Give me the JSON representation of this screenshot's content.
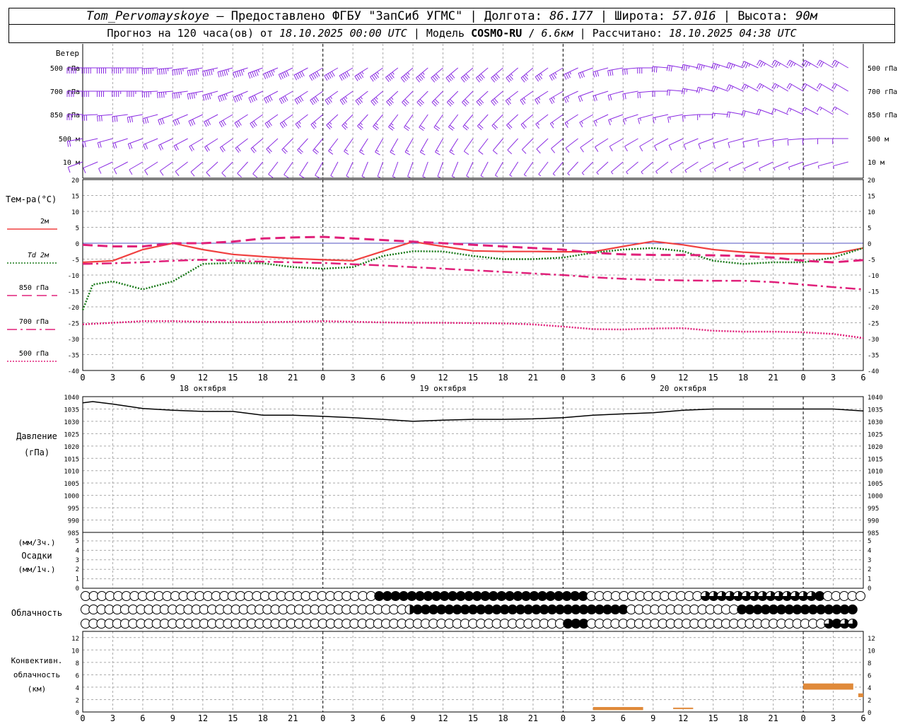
{
  "header": {
    "station": "Tom_Pervomayskoye",
    "provided_by": "Предоставлено ФГБУ \"ЗапСиб УГМС\"",
    "lon_label": "Долгота:",
    "lon_value": "86.177",
    "lat_label": "Широта:",
    "lat_value": "57.016",
    "alt_label": "Высота:",
    "alt_value": "90м",
    "forecast_label": "Прогноз на 120 часа(ов) от",
    "forecast_start": "18.10.2025 00:00 UTC",
    "model_label": "Модель",
    "model_name": "COSMO-RU",
    "model_res": "6.6км",
    "computed_label": "Рассчитано:",
    "computed_time": "18.10.2025 04:38 UTC"
  },
  "colors": {
    "wind": "#8a2be2",
    "t2m": "#f04040",
    "td2m": "#1a7a1a",
    "t850": "#e0207a",
    "t700": "#e0207a",
    "t500": "#e0207a",
    "pressure": "#000000",
    "conv_cloud": "#e08a3a",
    "grid": "#aaaaaa"
  },
  "time_axis": {
    "hour_labels": [
      "0",
      "3",
      "6",
      "9",
      "12",
      "15",
      "18",
      "21",
      "0",
      "3",
      "6",
      "9",
      "12",
      "15",
      "18",
      "21",
      "0",
      "3",
      "6",
      "9",
      "12",
      "15",
      "18",
      "21",
      "0",
      "3",
      "6"
    ],
    "day_labels": [
      {
        "label": "18 октября",
        "hour": 12
      },
      {
        "label": "19 октября",
        "hour": 36
      },
      {
        "label": "20 октября",
        "hour": 60
      }
    ]
  },
  "wind_panel": {
    "title": "Ветер",
    "levels": [
      "500 гПа",
      "700 гПа",
      "850 гПа",
      "500 м",
      "10  м"
    ]
  },
  "temp_panel": {
    "title": "Тем-ра(°C)",
    "legend": [
      {
        "label": "2м",
        "key": "t2m"
      },
      {
        "label": "Td  2м",
        "key": "td2m"
      },
      {
        "label": "850 гПа",
        "key": "t850"
      },
      {
        "label": "700 гПа",
        "key": "t700"
      },
      {
        "label": "500 гПа",
        "key": "t500"
      }
    ],
    "ticks": [
      "20",
      "15",
      "10",
      "5",
      "0",
      "-5",
      "-10",
      "-15",
      "-20",
      "-25",
      "-30",
      "-35",
      "-40"
    ]
  },
  "pressure_panel": {
    "title1": "Давление",
    "title2": "(гПа)",
    "ticks": [
      "1040",
      "1035",
      "1030",
      "1025",
      "1020",
      "1015",
      "1010",
      "1005",
      "1000",
      "995",
      "990",
      "985"
    ]
  },
  "precip_panel": {
    "title1": "(мм/3ч.)",
    "title2": "Осадки",
    "title3": "(мм/1ч.)",
    "ticks": [
      "5",
      "4",
      "3",
      "2",
      "1",
      "0"
    ]
  },
  "cloud_panel": {
    "title": "Облачность"
  },
  "conv_panel": {
    "title1": "Конвективн.",
    "title2": "облачность",
    "title3": "(км)",
    "ticks": [
      "12",
      "10",
      "8",
      "6",
      "4",
      "2",
      "0"
    ]
  },
  "chart_data": {
    "type": "line",
    "x_unit": "hours since 18.10.2025 00:00 UTC",
    "xlim": [
      0,
      78
    ],
    "temperature": {
      "ylim": [
        -40,
        20
      ],
      "series": [
        {
          "name": "2м",
          "key": "t2m",
          "style": "solid",
          "x": [
            0,
            3,
            6,
            9,
            12,
            15,
            18,
            21,
            24,
            27,
            30,
            33,
            36,
            39,
            42,
            45,
            48,
            51,
            54,
            57,
            60,
            63,
            66,
            69,
            72,
            75,
            78
          ],
          "y": [
            -6,
            -5.5,
            -2,
            0,
            -2,
            -3.5,
            -4.2,
            -4.8,
            -5.2,
            -5.5,
            -2.5,
            0.5,
            -1,
            -2.4,
            -2.6,
            -2.6,
            -2.7,
            -2.7,
            -1,
            0.6,
            -0.5,
            -2,
            -2.8,
            -3.3,
            -3.3,
            -3.3,
            -1.5
          ]
        },
        {
          "name": "Td  2м",
          "key": "td2m",
          "style": "dotted",
          "x": [
            0,
            1,
            3,
            6,
            9,
            12,
            15,
            18,
            21,
            24,
            27,
            30,
            33,
            36,
            39,
            42,
            45,
            48,
            51,
            54,
            57,
            60,
            63,
            66,
            69,
            72,
            75,
            78
          ],
          "y": [
            -21,
            -13,
            -12,
            -14.5,
            -12,
            -6.5,
            -6.2,
            -6.3,
            -7.5,
            -8,
            -7.5,
            -4,
            -2.5,
            -2.6,
            -4,
            -5,
            -5,
            -4.5,
            -3,
            -2,
            -1.5,
            -2.5,
            -5.5,
            -6.5,
            -6,
            -6,
            -4.5,
            -1.5
          ]
        },
        {
          "name": "850 гПа",
          "key": "t850",
          "style": "dashed",
          "x": [
            0,
            3,
            6,
            9,
            12,
            15,
            18,
            21,
            24,
            27,
            30,
            33,
            36,
            39,
            42,
            45,
            48,
            51,
            54,
            57,
            60,
            63,
            66,
            69,
            72,
            75,
            78
          ],
          "y": [
            -0.5,
            -1,
            -1,
            0,
            0,
            0.5,
            1.5,
            1.8,
            2,
            1.5,
            1,
            0.5,
            0,
            -0.5,
            -1,
            -1.5,
            -2,
            -3,
            -3.5,
            -3.7,
            -3.7,
            -3.8,
            -4,
            -4.5,
            -5.5,
            -6,
            -5.3
          ]
        },
        {
          "name": "700 гПа",
          "key": "t700",
          "style": "dashdot",
          "x": [
            0,
            3,
            6,
            9,
            12,
            15,
            18,
            21,
            24,
            27,
            30,
            33,
            36,
            39,
            42,
            45,
            48,
            51,
            54,
            57,
            60,
            63,
            66,
            69,
            72,
            75,
            78
          ],
          "y": [
            -6.5,
            -6.3,
            -6,
            -5.5,
            -5.2,
            -5.5,
            -5.8,
            -6,
            -6.2,
            -6.6,
            -7,
            -7.5,
            -8,
            -8.5,
            -9,
            -9.5,
            -10,
            -10.7,
            -11.2,
            -11.5,
            -11.7,
            -11.8,
            -11.8,
            -12.2,
            -13,
            -13.8,
            -14.5
          ]
        },
        {
          "name": "500 гПа",
          "key": "t500",
          "style": "fine",
          "x": [
            0,
            3,
            6,
            9,
            12,
            15,
            18,
            21,
            24,
            27,
            30,
            33,
            36,
            39,
            42,
            45,
            48,
            51,
            54,
            57,
            60,
            63,
            66,
            69,
            72,
            75,
            78
          ],
          "y": [
            -25.5,
            -25,
            -24.5,
            -24.5,
            -24.7,
            -24.8,
            -24.8,
            -24.7,
            -24.5,
            -24.7,
            -24.9,
            -25,
            -25,
            -25.1,
            -25.2,
            -25.5,
            -26.2,
            -27,
            -27.1,
            -26.8,
            -26.7,
            -27.5,
            -27.8,
            -27.8,
            -28,
            -28.5,
            -29.8
          ]
        }
      ]
    },
    "pressure": {
      "ylim": [
        985,
        1040
      ],
      "x": [
        0,
        1,
        3,
        6,
        9,
        12,
        15,
        18,
        21,
        24,
        27,
        30,
        33,
        36,
        39,
        42,
        45,
        48,
        51,
        54,
        57,
        60,
        63,
        66,
        69,
        72,
        75,
        78
      ],
      "y": [
        1037.5,
        1038,
        1037,
        1035.2,
        1034.5,
        1034,
        1034,
        1032.5,
        1032.5,
        1032,
        1031.5,
        1030.8,
        1030,
        1030.5,
        1030.8,
        1030.8,
        1031,
        1031.5,
        1032.5,
        1033,
        1033.5,
        1034.5,
        1035,
        1035,
        1035,
        1035,
        1035,
        1034.2
      ]
    },
    "precipitation": {
      "ylim": [
        0,
        5
      ],
      "values": []
    },
    "cloud_cover": {
      "x_step_hours": 1,
      "x_start_hours": 0,
      "rows": [
        {
          "name": "upper",
          "values": "000000000000000000000000000000000000OOOOOOOOOOOOOOOOOOOOOOOOOO00000000000000ooooooooooooooO00000"
        },
        {
          "name": "middle",
          "values": "00000000000000000000000000000000000000000hOOOOOOOOOOOOOOOOOOOOOOOOOOO00000000000000OOOOOOOOOOOOOOOO"
        },
        {
          "name": "lower",
          "values": "0000000000000000000000000000000000000000000000000000000000000OOO000000000000000000000000000000oOooO"
        }
      ]
    },
    "convective_cloud": {
      "ylim": [
        0,
        13
      ],
      "segments": [
        {
          "x0": 51,
          "x1": 56,
          "base": 0.3,
          "top": 0.8
        },
        {
          "x0": 59,
          "x1": 61,
          "base": 0.6,
          "top": 0.7
        },
        {
          "x0": 72,
          "x1": 77,
          "base": 3.6,
          "top": 4.6
        },
        {
          "x0": 77.5,
          "x1": 78,
          "base": 2.4,
          "top": 3.0
        }
      ]
    },
    "wind": {
      "levels": [
        "500 гПа",
        "700 гПа",
        "850 гПа",
        "500 м",
        "10  м"
      ],
      "direction_deg": [
        [
          270,
          270,
          270,
          265,
          260,
          255,
          250,
          245,
          240,
          240,
          235,
          230,
          230,
          230,
          230,
          230,
          240,
          250,
          260,
          270,
          280,
          285,
          290,
          300,
          300,
          300,
          300
        ],
        [
          270,
          270,
          270,
          265,
          260,
          250,
          245,
          240,
          235,
          235,
          230,
          225,
          225,
          225,
          230,
          235,
          240,
          250,
          255,
          265,
          275,
          285,
          295,
          300,
          300,
          300,
          300
        ],
        [
          270,
          265,
          260,
          250,
          245,
          240,
          235,
          235,
          230,
          225,
          220,
          215,
          215,
          220,
          225,
          230,
          235,
          240,
          250,
          255,
          260,
          270,
          280,
          290,
          295,
          300,
          300
        ],
        [
          260,
          255,
          250,
          245,
          240,
          235,
          230,
          225,
          220,
          215,
          210,
          210,
          210,
          215,
          220,
          225,
          230,
          235,
          240,
          240,
          245,
          250,
          255,
          260,
          265,
          270,
          270
        ],
        [
          250,
          245,
          240,
          235,
          230,
          225,
          220,
          215,
          210,
          205,
          200,
          200,
          200,
          205,
          210,
          215,
          220,
          225,
          230,
          230,
          235,
          240,
          245,
          245,
          250,
          255,
          255
        ]
      ],
      "speed_ms": [
        [
          25,
          26,
          27,
          28,
          28,
          28,
          27,
          26,
          25,
          24,
          23,
          22,
          21,
          20,
          19,
          18,
          17,
          16,
          15,
          15,
          16,
          17,
          18,
          18,
          17,
          16,
          15
        ],
        [
          20,
          21,
          22,
          22,
          22,
          22,
          21,
          20,
          19,
          18,
          17,
          16,
          15,
          15,
          14,
          13,
          12,
          11,
          10,
          10,
          11,
          12,
          12,
          12,
          11,
          10,
          10
        ],
        [
          14,
          15,
          16,
          16,
          16,
          15,
          15,
          14,
          13,
          13,
          12,
          11,
          10,
          10,
          9,
          9,
          8,
          8,
          7,
          7,
          8,
          8,
          9,
          9,
          8,
          7,
          7
        ],
        [
          9,
          10,
          10,
          11,
          11,
          10,
          10,
          9,
          9,
          8,
          8,
          7,
          7,
          6,
          6,
          6,
          5,
          5,
          5,
          5,
          5,
          6,
          6,
          6,
          5,
          5,
          5
        ],
        [
          4,
          5,
          5,
          5,
          5,
          4,
          4,
          4,
          4,
          3,
          3,
          3,
          3,
          3,
          3,
          3,
          2,
          2,
          2,
          2,
          3,
          3,
          3,
          3,
          3,
          3,
          3
        ]
      ]
    }
  }
}
